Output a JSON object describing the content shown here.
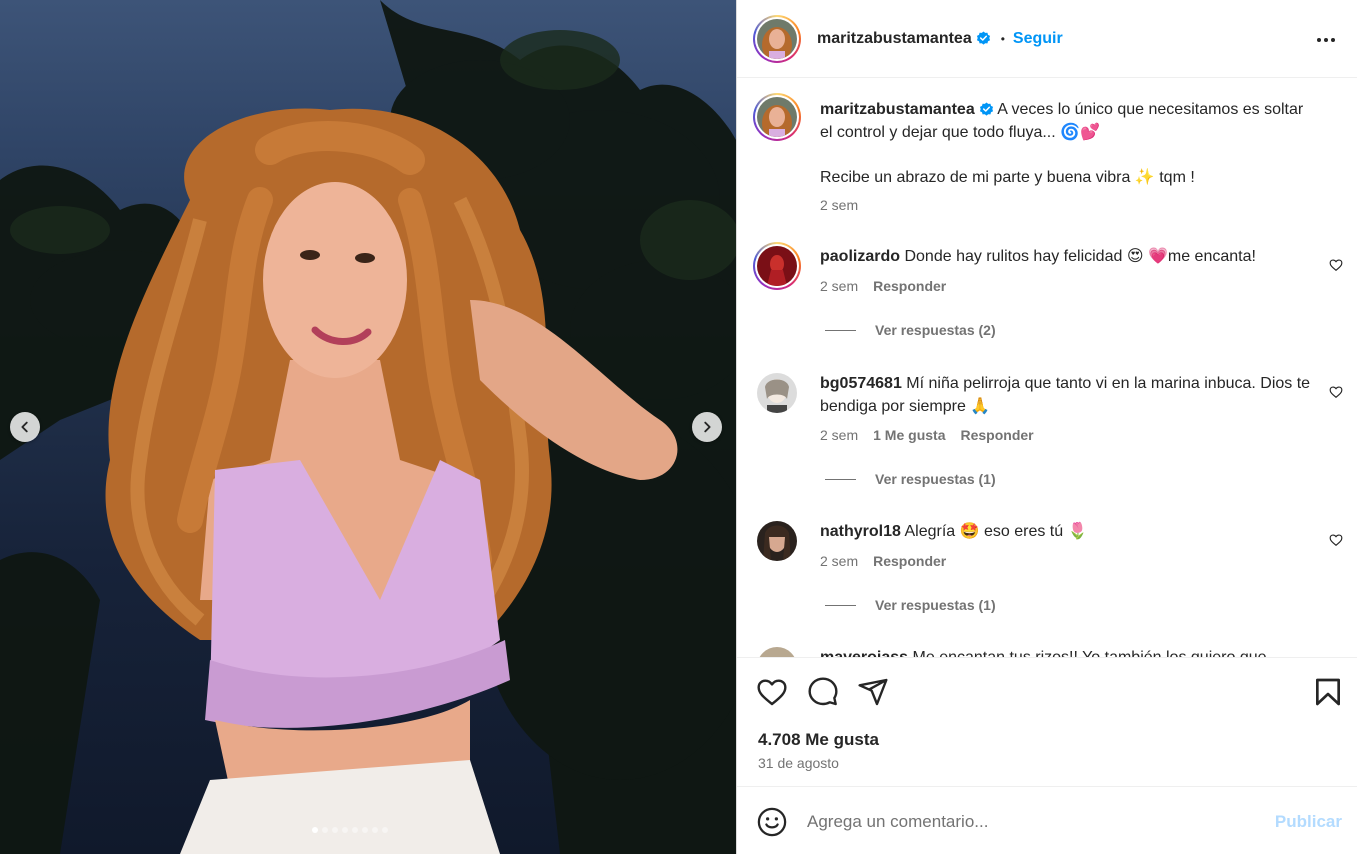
{
  "post": {
    "author": "maritzabustamantea",
    "separator": "•",
    "follow_label": "Seguir",
    "caption_line1": "A veces lo único que necesitamos es soltar el control y dejar que todo fluya... 🌀💕",
    "caption_line2": "Recibe un abrazo de mi parte y buena vibra ✨ tqm !",
    "caption_time": "2 sem"
  },
  "comments": [
    {
      "username": "paolizardo",
      "text": "Donde hay rulitos hay felicidad 😍 💗me encanta!",
      "time": "2 sem",
      "likes": "",
      "reply_label": "Responder",
      "view_replies": "Ver respuestas (2)"
    },
    {
      "username": "bg0574681",
      "text": "Mí niña pelirroja que tanto vi en la marina inbuca. Dios te bendiga por siempre 🙏",
      "time": "2 sem",
      "likes": "1 Me gusta",
      "reply_label": "Responder",
      "view_replies": "Ver respuestas (1)"
    },
    {
      "username": "nathyrol18",
      "text": "Alegría 🤩 eso eres tú 🌷",
      "time": "2 sem",
      "likes": "",
      "reply_label": "Responder",
      "view_replies": "Ver respuestas (1)"
    },
    {
      "username": "maverojass",
      "text": "Me encantan tus rizos!! Yo también los quiero que"
    }
  ],
  "actions": {
    "icons": [
      "heart-icon",
      "comment-icon",
      "share-icon",
      "bookmark-icon"
    ],
    "likes": "4.708 Me gusta",
    "date": "31 de agosto"
  },
  "composer": {
    "placeholder": "Agrega un comentario...",
    "publish_label": "Publicar"
  },
  "media": {
    "slide_count": 8,
    "active_slide": 1
  },
  "colors": {
    "link_blue": "#0095f6",
    "publish_disabled": "#b3dbff",
    "verified_blue": "#0095f6"
  }
}
